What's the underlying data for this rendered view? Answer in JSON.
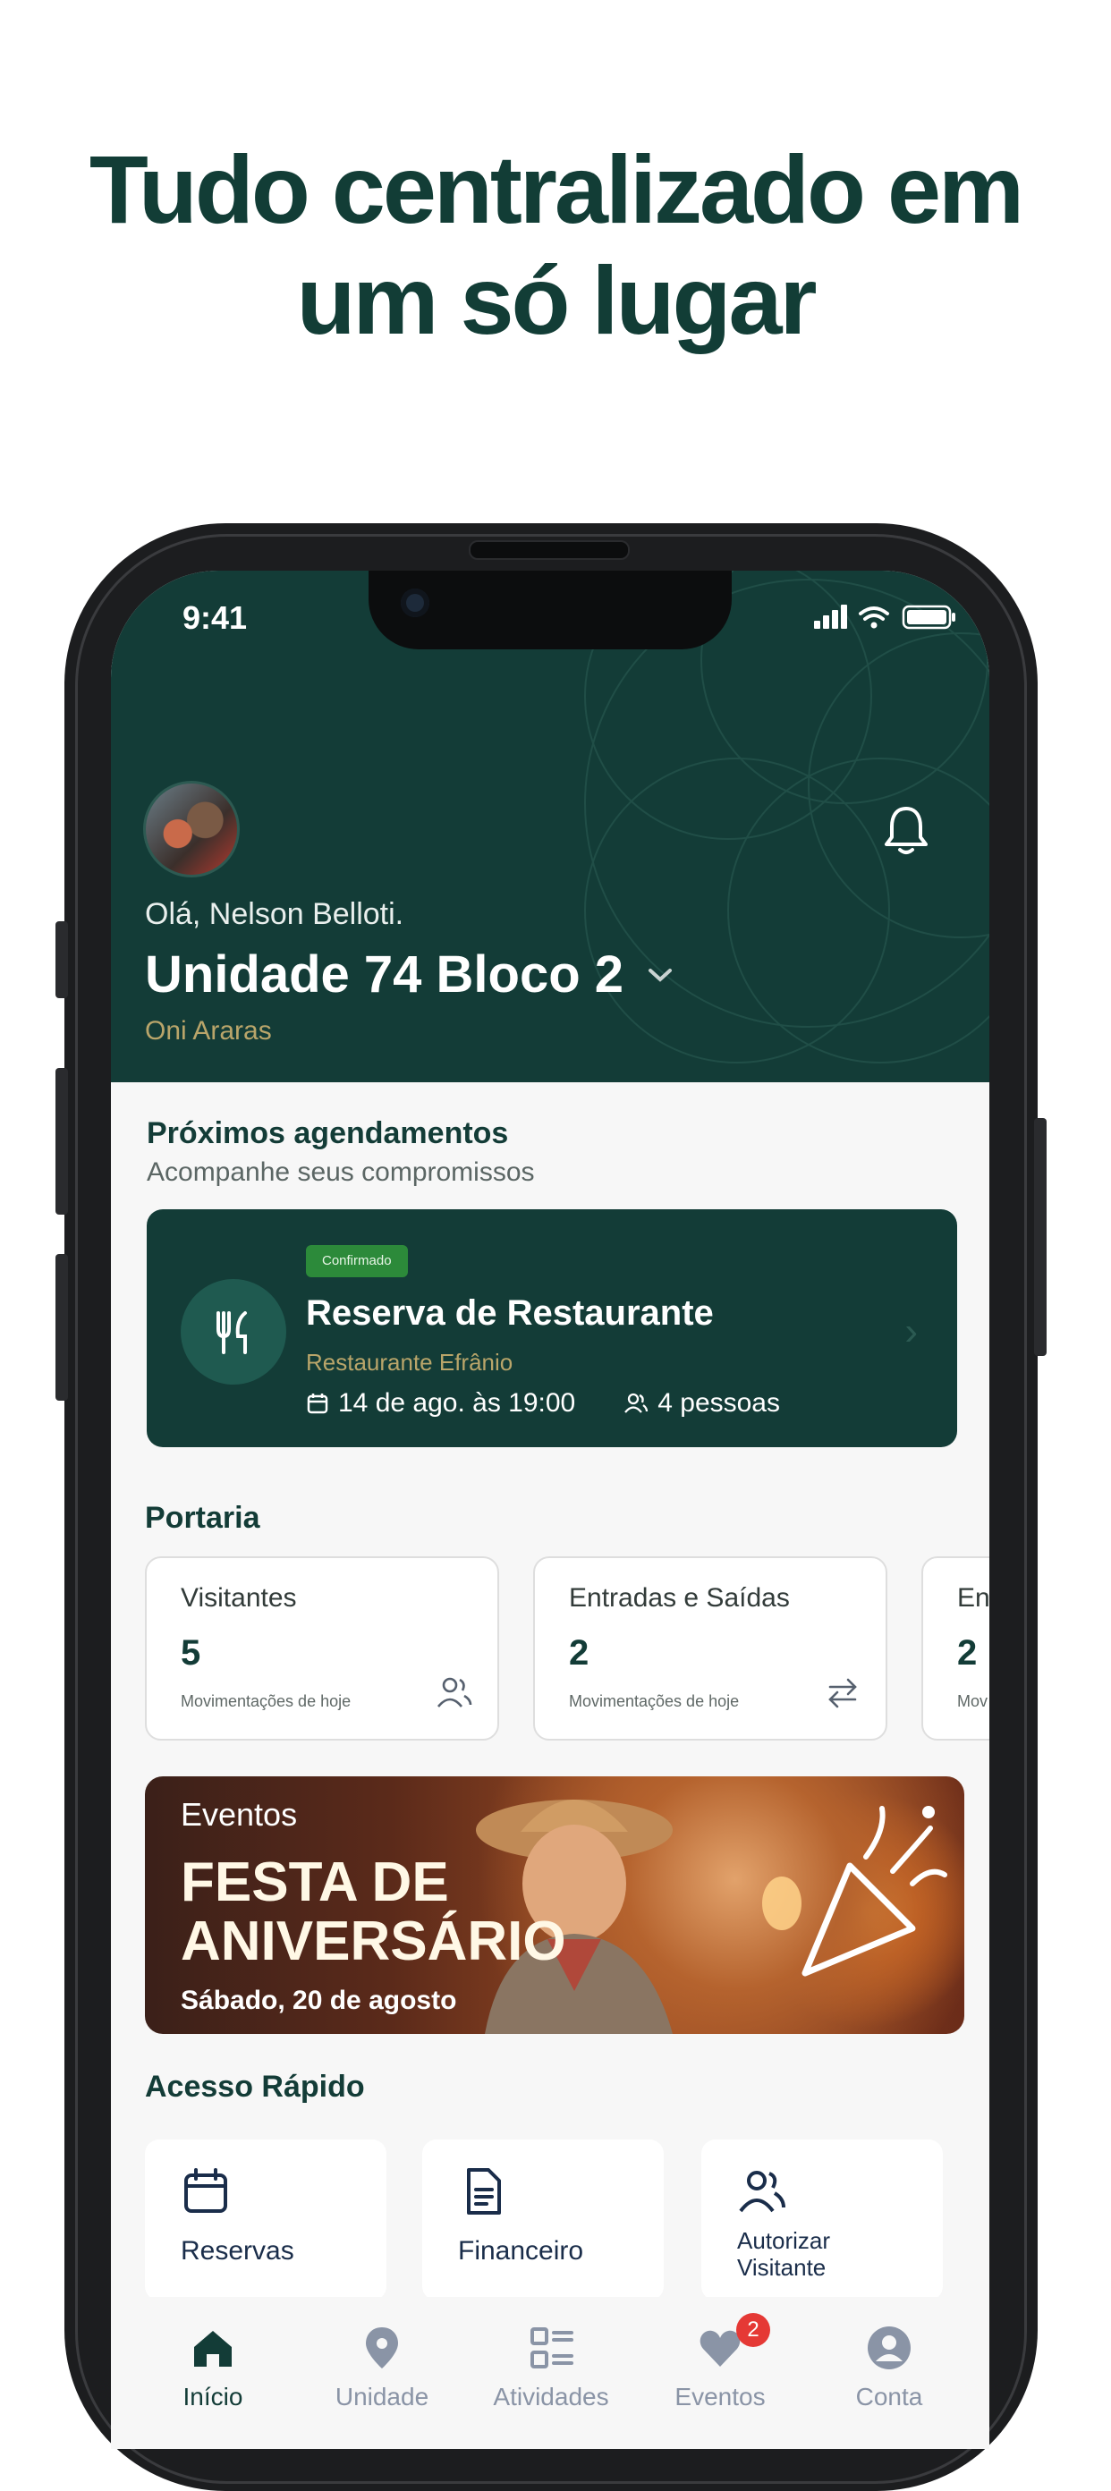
{
  "headline": {
    "line1": "Tudo centralizado em",
    "line2": "um só lugar"
  },
  "status_bar": {
    "time": "9:41"
  },
  "header": {
    "greeting": "Olá, Nelson Belloti.",
    "unit_title": "Unidade 74 Bloco 2",
    "condo_name": "Oni Araras"
  },
  "upcoming": {
    "title": "Próximos agendamentos",
    "subtitle": "Acompanhe seus compromissos",
    "booking": {
      "status": "Confirmado",
      "title": "Reserva de Restaurante",
      "place": "Restaurante Efrânio",
      "date": "14 de ago. às 19:00",
      "people": "4 pessoas"
    }
  },
  "portaria": {
    "title": "Portaria",
    "cards": [
      {
        "label": "Visitantes",
        "value": "5",
        "sub": "Movimentações de hoje",
        "icon": "users-icon"
      },
      {
        "label": "Entradas e Saídas",
        "value": "2",
        "sub": "Movimentações de hoje",
        "icon": "swap-arrows-icon"
      },
      {
        "label": "En",
        "value": "2",
        "sub": "Mov",
        "icon": ""
      }
    ]
  },
  "event": {
    "label": "Eventos",
    "title": "FESTA DE ANIVERSÁRIO",
    "date": "Sábado, 20 de agosto"
  },
  "quick_access": {
    "title": "Acesso Rápido",
    "items": [
      {
        "label": "Reservas",
        "icon": "calendar-icon"
      },
      {
        "label": "Financeiro",
        "icon": "document-icon"
      },
      {
        "label": "Autorizar Visitante",
        "icon": "users-icon"
      }
    ]
  },
  "tabbar": {
    "items": [
      {
        "label": "Início",
        "icon": "home-icon",
        "active": true
      },
      {
        "label": "Unidade",
        "icon": "location-pin-icon"
      },
      {
        "label": "Atividades",
        "icon": "list-icon"
      },
      {
        "label": "Eventos",
        "icon": "heart-icon",
        "badge": "2"
      },
      {
        "label": "Conta",
        "icon": "account-icon"
      }
    ]
  },
  "colors": {
    "brand": "#133c37",
    "accent_gold": "#b9a56a",
    "confirmed": "#2c8a3a",
    "badge": "#e53935"
  }
}
